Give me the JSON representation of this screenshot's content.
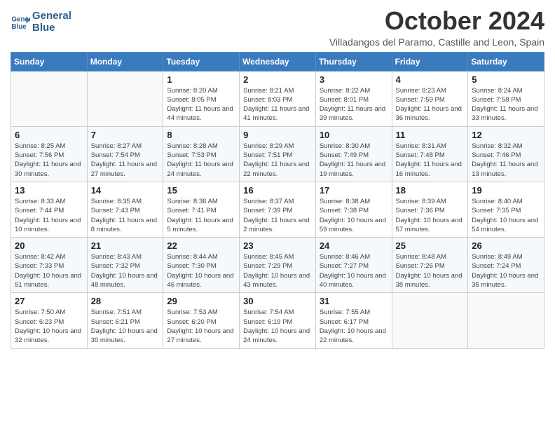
{
  "header": {
    "logo_line1": "General",
    "logo_line2": "Blue",
    "month_title": "October 2024",
    "subtitle": "Villadangos del Paramo, Castille and Leon, Spain"
  },
  "days_of_week": [
    "Sunday",
    "Monday",
    "Tuesday",
    "Wednesday",
    "Thursday",
    "Friday",
    "Saturday"
  ],
  "weeks": [
    [
      {
        "day": "",
        "info": ""
      },
      {
        "day": "",
        "info": ""
      },
      {
        "day": "1",
        "info": "Sunrise: 8:20 AM\nSunset: 8:05 PM\nDaylight: 11 hours and 44 minutes."
      },
      {
        "day": "2",
        "info": "Sunrise: 8:21 AM\nSunset: 8:03 PM\nDaylight: 11 hours and 41 minutes."
      },
      {
        "day": "3",
        "info": "Sunrise: 8:22 AM\nSunset: 8:01 PM\nDaylight: 11 hours and 39 minutes."
      },
      {
        "day": "4",
        "info": "Sunrise: 8:23 AM\nSunset: 7:59 PM\nDaylight: 11 hours and 36 minutes."
      },
      {
        "day": "5",
        "info": "Sunrise: 8:24 AM\nSunset: 7:58 PM\nDaylight: 11 hours and 33 minutes."
      }
    ],
    [
      {
        "day": "6",
        "info": "Sunrise: 8:25 AM\nSunset: 7:56 PM\nDaylight: 11 hours and 30 minutes."
      },
      {
        "day": "7",
        "info": "Sunrise: 8:27 AM\nSunset: 7:54 PM\nDaylight: 11 hours and 27 minutes."
      },
      {
        "day": "8",
        "info": "Sunrise: 8:28 AM\nSunset: 7:53 PM\nDaylight: 11 hours and 24 minutes."
      },
      {
        "day": "9",
        "info": "Sunrise: 8:29 AM\nSunset: 7:51 PM\nDaylight: 11 hours and 22 minutes."
      },
      {
        "day": "10",
        "info": "Sunrise: 8:30 AM\nSunset: 7:49 PM\nDaylight: 11 hours and 19 minutes."
      },
      {
        "day": "11",
        "info": "Sunrise: 8:31 AM\nSunset: 7:48 PM\nDaylight: 11 hours and 16 minutes."
      },
      {
        "day": "12",
        "info": "Sunrise: 8:32 AM\nSunset: 7:46 PM\nDaylight: 11 hours and 13 minutes."
      }
    ],
    [
      {
        "day": "13",
        "info": "Sunrise: 8:33 AM\nSunset: 7:44 PM\nDaylight: 11 hours and 10 minutes."
      },
      {
        "day": "14",
        "info": "Sunrise: 8:35 AM\nSunset: 7:43 PM\nDaylight: 11 hours and 8 minutes."
      },
      {
        "day": "15",
        "info": "Sunrise: 8:36 AM\nSunset: 7:41 PM\nDaylight: 11 hours and 5 minutes."
      },
      {
        "day": "16",
        "info": "Sunrise: 8:37 AM\nSunset: 7:39 PM\nDaylight: 11 hours and 2 minutes."
      },
      {
        "day": "17",
        "info": "Sunrise: 8:38 AM\nSunset: 7:38 PM\nDaylight: 10 hours and 59 minutes."
      },
      {
        "day": "18",
        "info": "Sunrise: 8:39 AM\nSunset: 7:36 PM\nDaylight: 10 hours and 57 minutes."
      },
      {
        "day": "19",
        "info": "Sunrise: 8:40 AM\nSunset: 7:35 PM\nDaylight: 10 hours and 54 minutes."
      }
    ],
    [
      {
        "day": "20",
        "info": "Sunrise: 8:42 AM\nSunset: 7:33 PM\nDaylight: 10 hours and 51 minutes."
      },
      {
        "day": "21",
        "info": "Sunrise: 8:43 AM\nSunset: 7:32 PM\nDaylight: 10 hours and 48 minutes."
      },
      {
        "day": "22",
        "info": "Sunrise: 8:44 AM\nSunset: 7:30 PM\nDaylight: 10 hours and 46 minutes."
      },
      {
        "day": "23",
        "info": "Sunrise: 8:45 AM\nSunset: 7:29 PM\nDaylight: 10 hours and 43 minutes."
      },
      {
        "day": "24",
        "info": "Sunrise: 8:46 AM\nSunset: 7:27 PM\nDaylight: 10 hours and 40 minutes."
      },
      {
        "day": "25",
        "info": "Sunrise: 8:48 AM\nSunset: 7:26 PM\nDaylight: 10 hours and 38 minutes."
      },
      {
        "day": "26",
        "info": "Sunrise: 8:49 AM\nSunset: 7:24 PM\nDaylight: 10 hours and 35 minutes."
      }
    ],
    [
      {
        "day": "27",
        "info": "Sunrise: 7:50 AM\nSunset: 6:23 PM\nDaylight: 10 hours and 32 minutes."
      },
      {
        "day": "28",
        "info": "Sunrise: 7:51 AM\nSunset: 6:21 PM\nDaylight: 10 hours and 30 minutes."
      },
      {
        "day": "29",
        "info": "Sunrise: 7:53 AM\nSunset: 6:20 PM\nDaylight: 10 hours and 27 minutes."
      },
      {
        "day": "30",
        "info": "Sunrise: 7:54 AM\nSunset: 6:19 PM\nDaylight: 10 hours and 24 minutes."
      },
      {
        "day": "31",
        "info": "Sunrise: 7:55 AM\nSunset: 6:17 PM\nDaylight: 10 hours and 22 minutes."
      },
      {
        "day": "",
        "info": ""
      },
      {
        "day": "",
        "info": ""
      }
    ]
  ]
}
